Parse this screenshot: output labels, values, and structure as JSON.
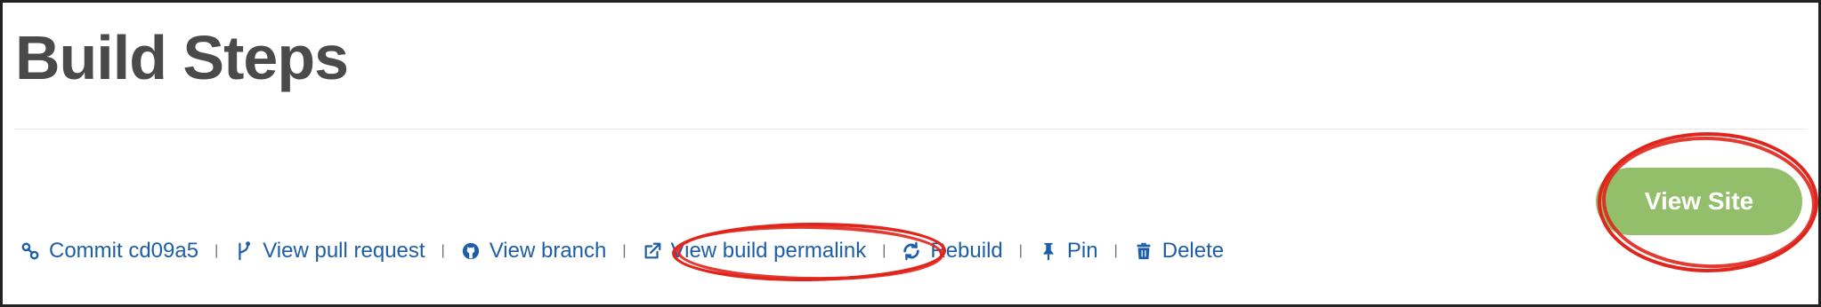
{
  "page_title": "Build Steps",
  "actions": {
    "commit": {
      "label": "Commit cd09a5",
      "icon": "link-icon"
    },
    "pull_request": {
      "label": "View pull request",
      "icon": "git-pull-request-icon"
    },
    "branch": {
      "label": "View branch",
      "icon": "github-icon"
    },
    "permalink": {
      "label": "View build permalink",
      "icon": "external-link-icon"
    },
    "rebuild": {
      "label": "Rebuild",
      "icon": "refresh-icon"
    },
    "pin": {
      "label": "Pin",
      "icon": "pin-icon"
    },
    "delete": {
      "label": "Delete",
      "icon": "trash-icon"
    },
    "separator": "|"
  },
  "view_site_button": {
    "label": "View Site"
  },
  "colors": {
    "link": "#1d5ea8",
    "button": "#93bf6a",
    "annotation": "#e0261c",
    "title": "#4a4a4a"
  }
}
